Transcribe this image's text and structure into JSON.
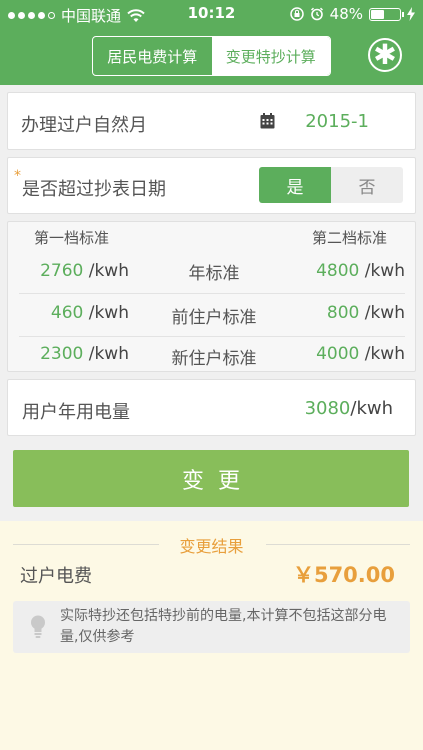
{
  "status_bar": {
    "carrier": "中国联通",
    "time": "10:12",
    "battery": "48%",
    "battery_level": 0.48
  },
  "header": {
    "tabs": [
      {
        "label": "居民电费计算",
        "active": false
      },
      {
        "label": "变更特抄计算",
        "active": true
      }
    ],
    "menu_icon": "asterisk-icon"
  },
  "form": {
    "transfer_month_label": "办理过户自然月",
    "transfer_month_value": "2015-1",
    "required_mark": "*",
    "over_reading_label": "是否超过抄表日期",
    "yes_label": "是",
    "no_label": "否",
    "over_reading_selected": "是"
  },
  "standards": {
    "col_first": "第一档标准",
    "col_second": "第二档标准",
    "rows": [
      {
        "first": "2760",
        "unit1": "/kwh",
        "label": "年标准",
        "second": "4800",
        "unit2": "/kwh"
      },
      {
        "first": "460",
        "unit1": "/kwh",
        "label": "前住户标准",
        "second": "800",
        "unit2": "/kwh"
      },
      {
        "first": "2300",
        "unit1": "/kwh",
        "label": "新住户标准",
        "second": "4000",
        "unit2": "/kwh"
      }
    ]
  },
  "usage": {
    "label": "用户年用电量",
    "value": "3080",
    "unit": "/kwh"
  },
  "action": {
    "change_label": "变更"
  },
  "result": {
    "title": "变更结果",
    "fee_label": "过户电费",
    "fee_value": "￥570.00",
    "note": "实际特抄还包括特抄前的电量,本计算不包括这部分电量,仅供参考"
  },
  "colors": {
    "primary_green": "#5cae5c",
    "button_green": "#88be5a",
    "accent_orange": "#e89f3c",
    "result_bg": "#fdf9e5"
  }
}
